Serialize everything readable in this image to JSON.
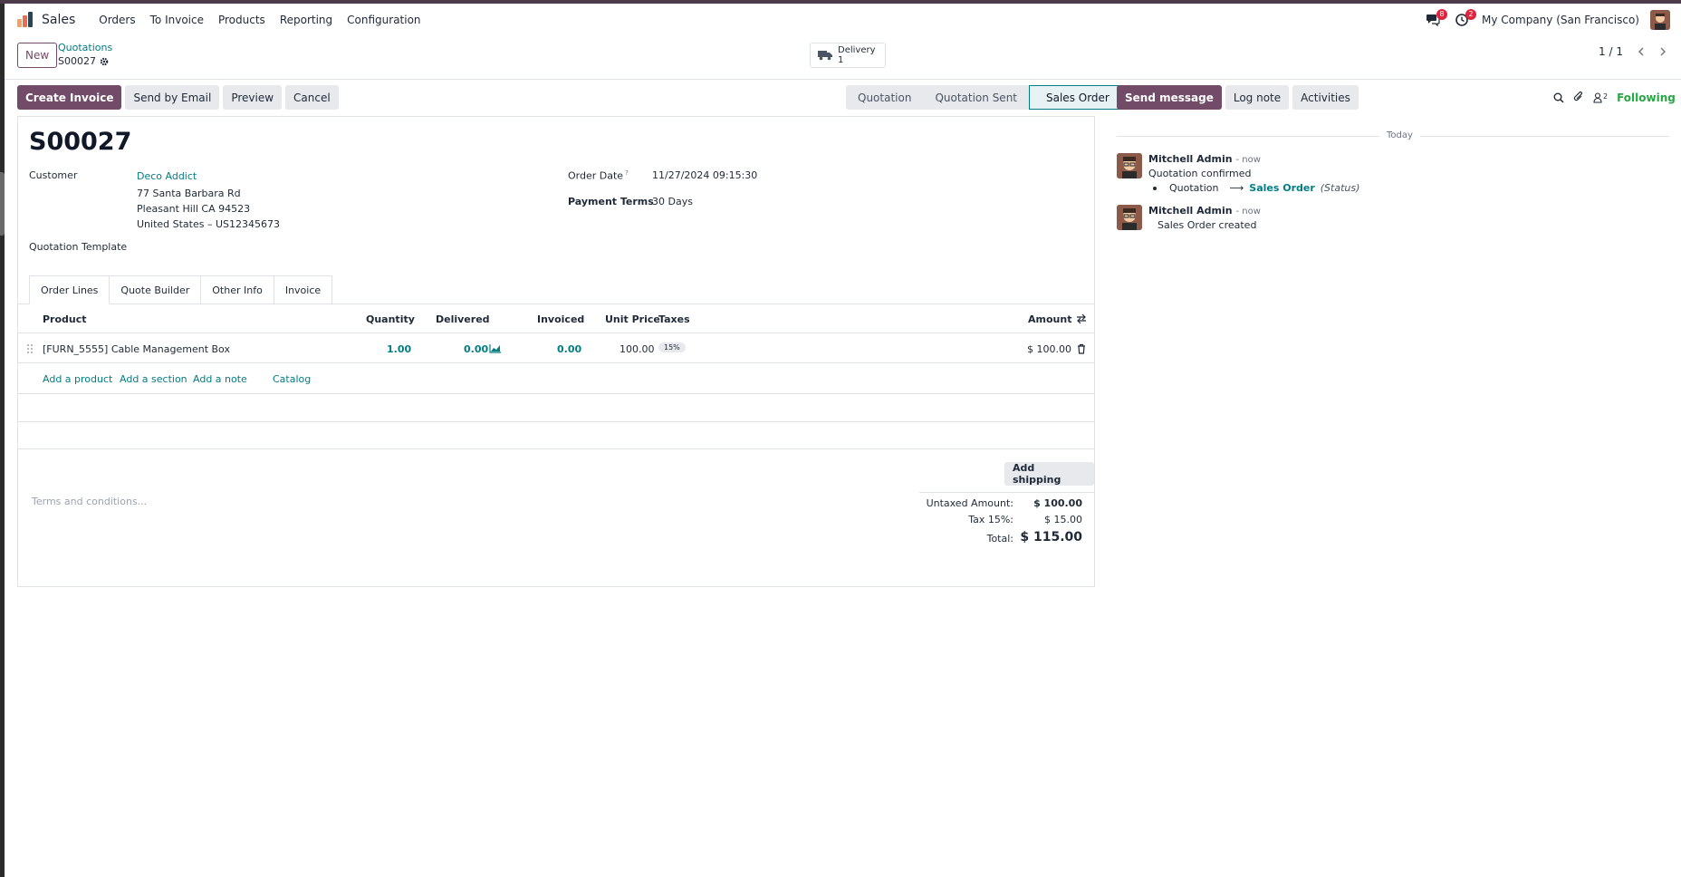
{
  "nav": {
    "app_name": "Sales",
    "menu": [
      "Orders",
      "To Invoice",
      "Products",
      "Reporting",
      "Configuration"
    ],
    "messages_count": "8",
    "activities_count": "2",
    "company": "My Company (San Francisco)"
  },
  "control": {
    "new_label": "New",
    "breadcrumb_parent": "Quotations",
    "breadcrumb_current": "S00027",
    "delivery_label": "Delivery",
    "delivery_count": "1",
    "pager": "1 / 1"
  },
  "actions": {
    "create_invoice": "Create Invoice",
    "send_by_email": "Send by Email",
    "preview": "Preview",
    "cancel": "Cancel"
  },
  "statusbar": [
    "Quotation",
    "Quotation Sent",
    "Sales Order"
  ],
  "form": {
    "title": "S00027",
    "customer_label": "Customer",
    "customer_name": "Deco Addict",
    "address_line1": "77 Santa Barbara Rd",
    "address_line2": "Pleasant Hill CA 94523",
    "address_line3": "United States – US12345673",
    "quotation_template_label": "Quotation Template",
    "order_date_label": "Order Date",
    "order_date_help": "?",
    "order_date_value": "11/27/2024 09:15:30",
    "payment_terms_label": "Payment Terms",
    "payment_terms_value": "30 Days"
  },
  "tabs": [
    "Order Lines",
    "Quote Builder",
    "Other Info",
    "Invoice"
  ],
  "table": {
    "headers": {
      "product": "Product",
      "quantity": "Quantity",
      "delivered": "Delivered",
      "invoiced": "Invoiced",
      "unit_price": "Unit Price",
      "taxes": "Taxes",
      "amount": "Amount"
    },
    "rows": [
      {
        "product": "[FURN_5555] Cable Management Box",
        "quantity": "1.00",
        "delivered": "0.00",
        "invoiced": "0.00",
        "unit_price": "100.00",
        "tax": "15%",
        "amount": "$ 100.00"
      }
    ],
    "add_product": "Add a product",
    "add_section": "Add a section",
    "add_note": "Add a note",
    "catalog": "Catalog"
  },
  "footer": {
    "add_shipping": "Add shipping",
    "terms_placeholder": "Terms and conditions...",
    "untaxed_label": "Untaxed Amount:",
    "untaxed_value": "$ 100.00",
    "tax_label": "Tax 15%:",
    "tax_value": "$ 15.00",
    "total_label": "Total:",
    "total_value": "$ 115.00"
  },
  "chatter": {
    "send_message": "Send message",
    "log_note": "Log note",
    "activities": "Activities",
    "followers_count": "2",
    "following": "Following",
    "date_separator": "Today",
    "messages": [
      {
        "author": "Mitchell Admin",
        "when": "- now",
        "body": "Quotation confirmed",
        "tracking_old": "Quotation",
        "tracking_new": "Sales Order",
        "tracking_field": "(Status)"
      },
      {
        "author": "Mitchell Admin",
        "when": "- now",
        "body": "Sales Order created"
      }
    ]
  },
  "colors": {
    "brand": "#714b67",
    "link": "#017e84",
    "badge": "#e0243c",
    "following": "#28a745"
  }
}
